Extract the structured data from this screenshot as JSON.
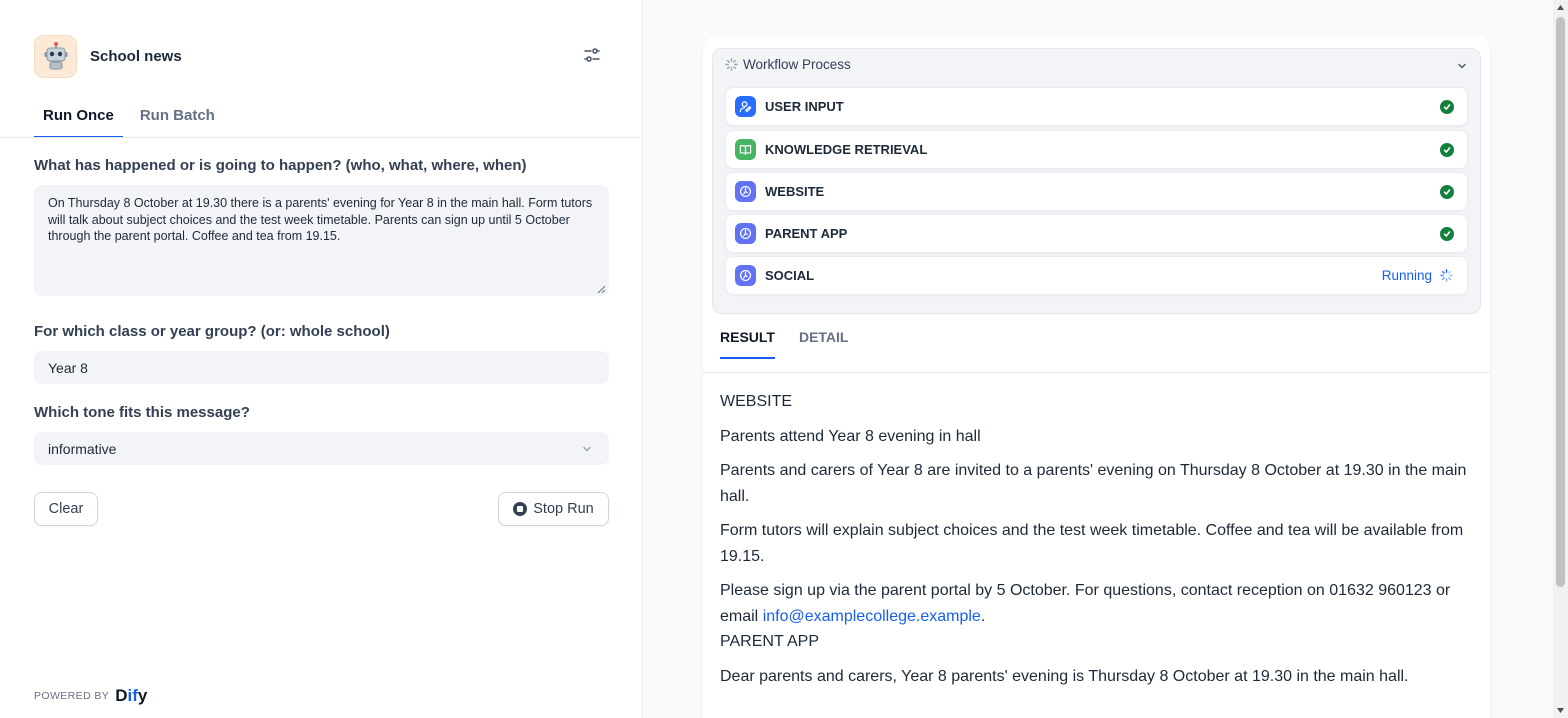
{
  "app": {
    "title": "School news",
    "icon": "robot-icon"
  },
  "tabs": {
    "run_once": "Run Once",
    "run_batch": "Run Batch"
  },
  "form": {
    "q1_label": "What has happened or is going to happen? (who, what, where, when)",
    "q1_value": "On Thursday 8 October at 19.30 there is a parents' evening for Year 8 in the main hall. Form tutors will talk about subject choices and the test week timetable. Parents can sign up until 5 October through the parent portal. Coffee and tea from 19.15.",
    "q2_label": "For which class or year group? (or: whole school)",
    "q2_value": "Year 8",
    "q3_label": "Which tone fits this message?",
    "q3_value": "informative",
    "clear_label": "Clear",
    "stop_label": "Stop Run"
  },
  "footer": {
    "powered_by": "POWERED BY",
    "logo": "Dify"
  },
  "workflow": {
    "title": "Workflow Process",
    "nodes": [
      {
        "title": "USER INPUT",
        "status": "done"
      },
      {
        "title": "KNOWLEDGE RETRIEVAL",
        "status": "done"
      },
      {
        "title": "WEBSITE",
        "status": "done"
      },
      {
        "title": "PARENT APP",
        "status": "done"
      },
      {
        "title": "SOCIAL",
        "status": "running",
        "status_label": "Running"
      }
    ]
  },
  "result_tabs": {
    "result": "RESULT",
    "detail": "DETAIL"
  },
  "result": {
    "heading1": "WEBSITE",
    "title": "Parents attend Year 8 evening in hall",
    "p1": "Parents and carers of Year 8 are invited to a parents' evening on Thursday 8 October at 19.30 in the main hall.",
    "p2": "Form tutors will explain subject choices and the test week timetable. Coffee and tea will be available from 19.15.",
    "p3_prefix": "Please sign up via the parent portal by 5 October. For questions, contact reception on 01632 960123 or email ",
    "p3_email": "info@examplecollege.example",
    "p3_suffix": ".",
    "heading2": "PARENT APP",
    "p4": "Dear parents and carers, Year 8 parents' evening is Thursday 8 October at 19.30 in the main hall."
  },
  "colors": {
    "accent": "#155eef",
    "success": "#15803d",
    "user_input_icon": "#296dff",
    "knowledge_icon": "#47b563",
    "llm_icon": "#6172f3"
  }
}
